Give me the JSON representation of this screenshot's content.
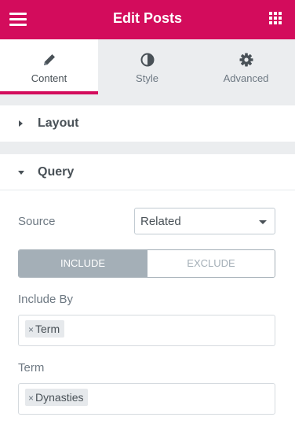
{
  "header": {
    "title": "Edit Posts",
    "menu_icon": "hamburger-menu-icon",
    "apps_icon": "grid-apps-icon",
    "accent_color": "#d30c5c"
  },
  "tabs": [
    {
      "label": "Content",
      "icon": "pencil-icon",
      "active": true
    },
    {
      "label": "Style",
      "icon": "half-circle-icon",
      "active": false
    },
    {
      "label": "Advanced",
      "icon": "gear-icon",
      "active": false
    }
  ],
  "sections": {
    "layout": {
      "title": "Layout",
      "expanded": false
    },
    "query": {
      "title": "Query",
      "expanded": true
    }
  },
  "query": {
    "source": {
      "label": "Source",
      "value": "Related"
    },
    "switch": {
      "include": "INCLUDE",
      "exclude": "EXCLUDE",
      "selected": "INCLUDE"
    },
    "include_by": {
      "label": "Include By",
      "tags": [
        "Term"
      ]
    },
    "term": {
      "label": "Term",
      "tags": [
        "Dynasties"
      ]
    },
    "remove_glyph": "×"
  }
}
